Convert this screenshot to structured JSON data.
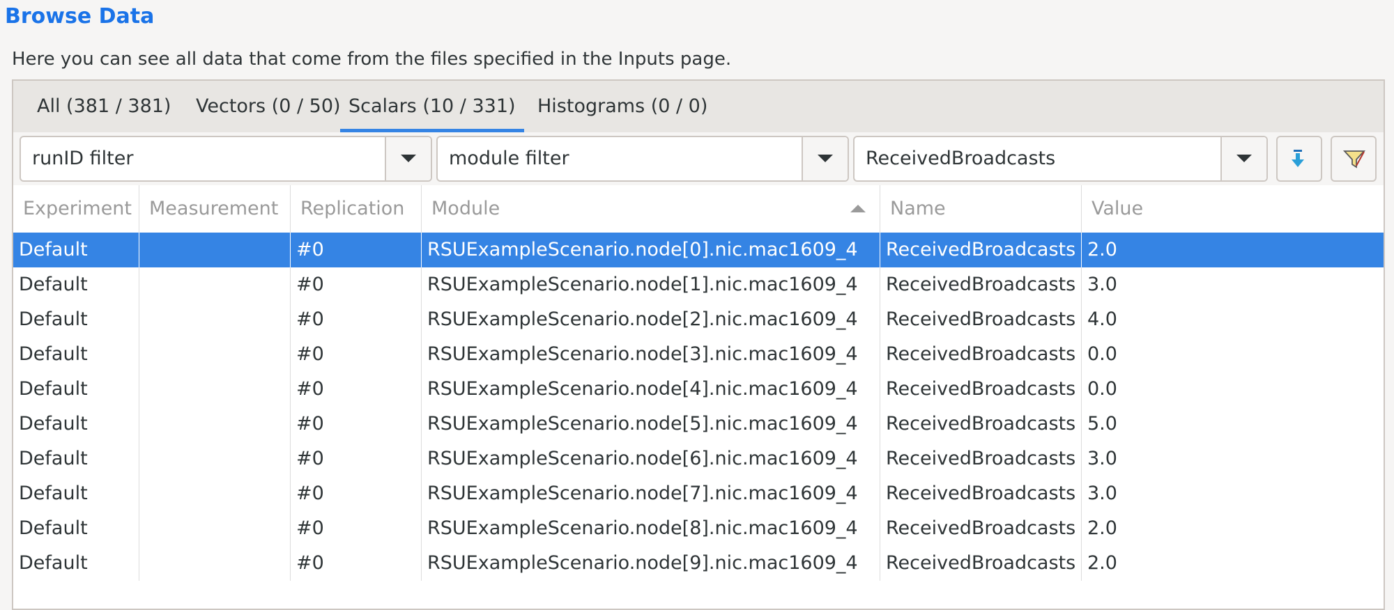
{
  "header": {
    "title": "Browse Data",
    "subtitle": "Here you can see all data that come from the files specified in the Inputs page."
  },
  "tabs": [
    {
      "label": "All (381 / 381)",
      "active": false
    },
    {
      "label": "Vectors (0 / 50)",
      "active": false
    },
    {
      "label": "Scalars (10 / 331)",
      "active": true
    },
    {
      "label": "Histograms (0 / 0)",
      "active": false
    }
  ],
  "filters": {
    "run_id": "runID filter",
    "module": "module filter",
    "name": "ReceivedBroadcasts",
    "dropdown_icon": "chevron-down-icon",
    "apply_icon": "arrow-down-icon",
    "advanced_icon": "funnel-icon"
  },
  "columns": [
    "Experiment",
    "Measurement",
    "Replication",
    "Module",
    "Name",
    "Value"
  ],
  "sort": {
    "column": "Module",
    "direction": "ascending"
  },
  "rows": [
    {
      "experiment": "Default",
      "measurement": "",
      "replication": "#0",
      "module": "RSUExampleScenario.node[0].nic.mac1609_4",
      "name": "ReceivedBroadcasts",
      "value": "2.0",
      "selected": true
    },
    {
      "experiment": "Default",
      "measurement": "",
      "replication": "#0",
      "module": "RSUExampleScenario.node[1].nic.mac1609_4",
      "name": "ReceivedBroadcasts",
      "value": "3.0"
    },
    {
      "experiment": "Default",
      "measurement": "",
      "replication": "#0",
      "module": "RSUExampleScenario.node[2].nic.mac1609_4",
      "name": "ReceivedBroadcasts",
      "value": "4.0"
    },
    {
      "experiment": "Default",
      "measurement": "",
      "replication": "#0",
      "module": "RSUExampleScenario.node[3].nic.mac1609_4",
      "name": "ReceivedBroadcasts",
      "value": "0.0"
    },
    {
      "experiment": "Default",
      "measurement": "",
      "replication": "#0",
      "module": "RSUExampleScenario.node[4].nic.mac1609_4",
      "name": "ReceivedBroadcasts",
      "value": "0.0"
    },
    {
      "experiment": "Default",
      "measurement": "",
      "replication": "#0",
      "module": "RSUExampleScenario.node[5].nic.mac1609_4",
      "name": "ReceivedBroadcasts",
      "value": "5.0"
    },
    {
      "experiment": "Default",
      "measurement": "",
      "replication": "#0",
      "module": "RSUExampleScenario.node[6].nic.mac1609_4",
      "name": "ReceivedBroadcasts",
      "value": "3.0"
    },
    {
      "experiment": "Default",
      "measurement": "",
      "replication": "#0",
      "module": "RSUExampleScenario.node[7].nic.mac1609_4",
      "name": "ReceivedBroadcasts",
      "value": "3.0"
    },
    {
      "experiment": "Default",
      "measurement": "",
      "replication": "#0",
      "module": "RSUExampleScenario.node[8].nic.mac1609_4",
      "name": "ReceivedBroadcasts",
      "value": "2.0"
    },
    {
      "experiment": "Default",
      "measurement": "",
      "replication": "#0",
      "module": "RSUExampleScenario.node[9].nic.mac1609_4",
      "name": "ReceivedBroadcasts",
      "value": "2.0"
    }
  ]
}
